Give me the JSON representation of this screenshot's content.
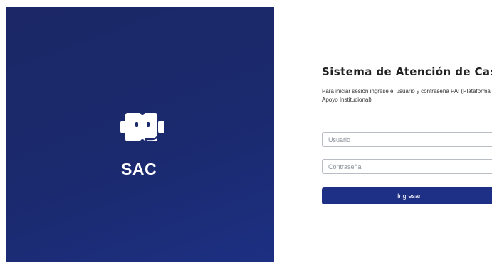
{
  "brand": {
    "name": "SAC",
    "logo_icon": "robot-icon",
    "panel_color": "#1b2a6e"
  },
  "login": {
    "title": "Sistema de Atención de Casos",
    "subtitle": "Para iniciar sesión ingrese el usuario y contraseña PAI (Plataforma Apoyo Institucional)",
    "username_placeholder": "Usuario",
    "username_value": "",
    "password_placeholder": "Contraseña",
    "password_value": "",
    "submit_label": "Ingresar",
    "button_color": "#1e2f86"
  }
}
